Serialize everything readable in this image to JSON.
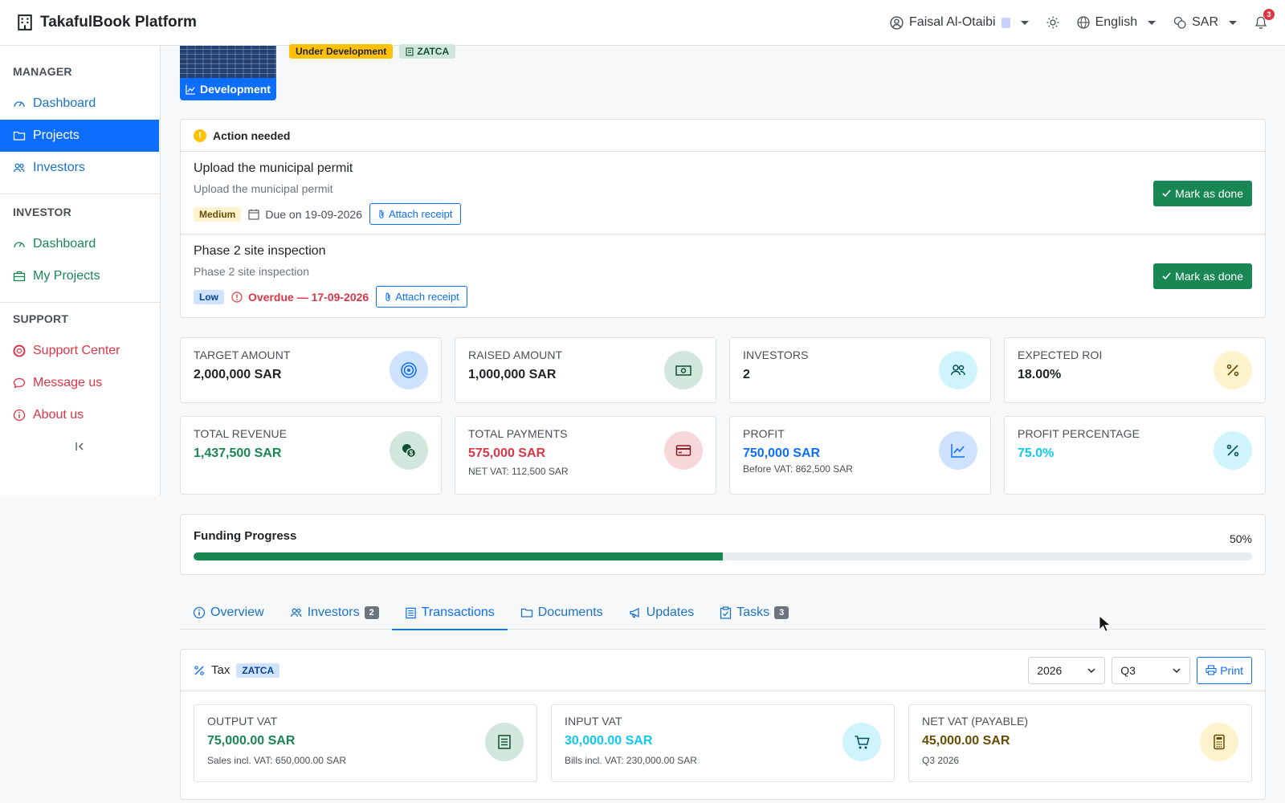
{
  "header": {
    "brand": "TakafulBook Platform",
    "user_name": "Faisal Al-Otaibi",
    "language": "English",
    "currency": "SAR",
    "notification_count": "3"
  },
  "sidebar": {
    "manager_title": "MANAGER",
    "manager_items": [
      "Dashboard",
      "Projects",
      "Investors"
    ],
    "investor_title": "INVESTOR",
    "investor_items": [
      "Dashboard",
      "My Projects"
    ],
    "support_title": "SUPPORT",
    "support_items": [
      "Support Center",
      "Message us",
      "About us"
    ]
  },
  "project": {
    "stage_label": "Development",
    "status_badge": "Under Development",
    "zatca_badge": "ZATCA"
  },
  "action_needed": {
    "title": "Action needed",
    "tasks": [
      {
        "title": "Upload the municipal permit",
        "description": "Upload the municipal permit",
        "priority": "Medium",
        "due": "Due on 19-09-2026",
        "attach_label": "Attach receipt",
        "done_label": "Mark as done"
      },
      {
        "title": "Phase 2 site inspection",
        "description": "Phase 2 site inspection",
        "priority": "Low",
        "due": "Overdue — 17-09-2026",
        "attach_label": "Attach receipt",
        "done_label": "Mark as done"
      }
    ]
  },
  "stats": [
    {
      "label": "TARGET AMOUNT",
      "value": "2,000,000 SAR",
      "icon": "target-icon",
      "color": "#212529",
      "icon_bg": "#cfe2ff",
      "icon_fg": "#0d6efd"
    },
    {
      "label": "RAISED AMOUNT",
      "value": "1,000,000 SAR",
      "icon": "cash-icon",
      "color": "#212529",
      "icon_bg": "#d1e7dd",
      "icon_fg": "#0f5132"
    },
    {
      "label": "INVESTORS",
      "value": "2",
      "icon": "people-icon",
      "color": "#212529",
      "icon_bg": "#cff4fc",
      "icon_fg": "#055160"
    },
    {
      "label": "EXPECTED ROI",
      "value": "18.00%",
      "icon": "percent-icon",
      "color": "#212529",
      "icon_bg": "#fff3cd",
      "icon_fg": "#664d03"
    },
    {
      "label": "TOTAL REVENUE",
      "value": "1,437,500 SAR",
      "sub": "",
      "icon": "coins-icon",
      "color": "#198754",
      "icon_bg": "#d1e7dd",
      "icon_fg": "#0f5132"
    },
    {
      "label": "TOTAL PAYMENTS",
      "value": "575,000 SAR",
      "sub": "NET VAT: 112,500 SAR",
      "icon": "credit-card-icon",
      "color": "#dc3545",
      "icon_bg": "#f8d7da",
      "icon_fg": "#842029"
    },
    {
      "label": "PROFIT",
      "value": "750,000 SAR",
      "sub": "Before VAT: 862,500 SAR",
      "icon": "chart-up-icon",
      "color": "#0d6efd",
      "icon_bg": "#cfe2ff",
      "icon_fg": "#0d6efd"
    },
    {
      "label": "PROFIT PERCENTAGE",
      "value": "75.0%",
      "sub": "",
      "icon": "percent-icon",
      "color": "#0dcaf0",
      "icon_bg": "#cff4fc",
      "icon_fg": "#055160"
    }
  ],
  "funding": {
    "title": "Funding Progress",
    "percent_label": "50%",
    "progress": 0.5
  },
  "tabs": [
    {
      "label": "Overview",
      "count": ""
    },
    {
      "label": "Investors",
      "count": "2"
    },
    {
      "label": "Transactions",
      "count": ""
    },
    {
      "label": "Documents",
      "count": ""
    },
    {
      "label": "Updates",
      "count": ""
    },
    {
      "label": "Tasks",
      "count": "3"
    }
  ],
  "tax": {
    "title": "Tax",
    "badge": "ZATCA",
    "year": "2026",
    "quarter": "Q3",
    "print_label": "Print",
    "cards": [
      {
        "label": "OUTPUT VAT",
        "value": "75,000.00 SAR",
        "sub": "Sales incl. VAT: 650,000.00 SAR",
        "color": "#198754",
        "icon": "receipt-icon",
        "icon_bg": "#d1e7dd",
        "icon_fg": "#0f5132"
      },
      {
        "label": "INPUT VAT",
        "value": "30,000.00 SAR",
        "sub": "Bills incl. VAT: 230,000.00 SAR",
        "color": "#0dcaf0",
        "icon": "cart-icon",
        "icon_bg": "#cff4fc",
        "icon_fg": "#055160"
      },
      {
        "label": "NET VAT (PAYABLE)",
        "value": "45,000.00 SAR",
        "sub": "Q3 2026",
        "color": "#664d03",
        "icon": "calculator-icon",
        "icon_bg": "#fff3cd",
        "icon_fg": "#664d03"
      }
    ]
  }
}
